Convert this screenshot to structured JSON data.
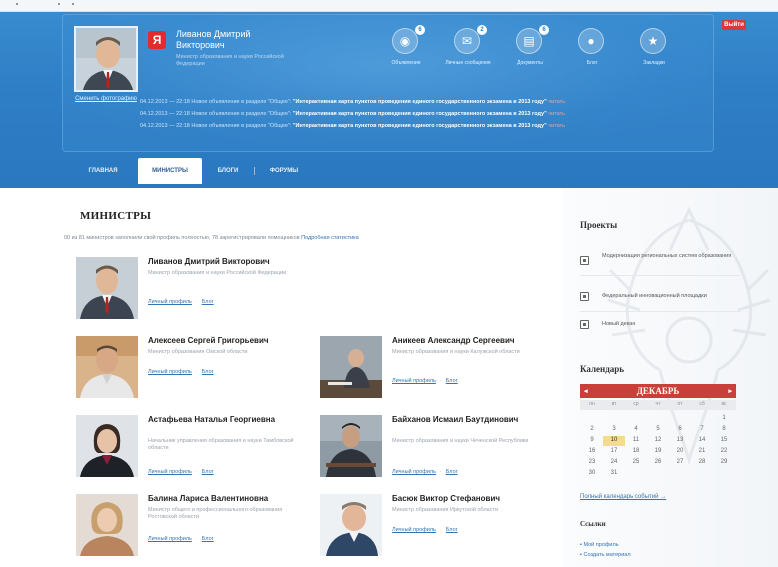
{
  "header": {
    "exit_label": "Выйти",
    "user": {
      "name": "Ливанов Дмитрий Викторович",
      "title": "Министр образования и науки Российской Федерации",
      "photo_link": "Сменить фотографию",
      "logo_letter": "Я"
    },
    "nav": [
      {
        "icon": "lightbulb-icon",
        "glyph": "◉",
        "label": "Объявления",
        "badge": "6"
      },
      {
        "icon": "mail-icon",
        "glyph": "✉",
        "label": "Личные сообщения",
        "badge": "2"
      },
      {
        "icon": "document-icon",
        "glyph": "▤",
        "label": "Документы",
        "badge": "6"
      },
      {
        "icon": "speech-bubble-icon",
        "glyph": "●",
        "label": "Блог",
        "badge": ""
      },
      {
        "icon": "star-icon",
        "glyph": "★",
        "label": "Закладки",
        "badge": ""
      }
    ],
    "news": [
      {
        "date": "04.12.2013 — 22:18",
        "text": "Новое объявление в разделе \"Общее\":",
        "bold": "\"Интерактивная карта пунктов проведения единого государственного экзамена в 2013 году\"",
        "more": "читать"
      },
      {
        "date": "04.12.2013 — 22:18",
        "text": "Новое объявление в разделе \"Общее\":",
        "bold": "\"Интерактивная карта пунктов проведения единого государственного экзамена в 2013 году\"",
        "more": "читать"
      },
      {
        "date": "04.12.2013 — 22:18",
        "text": "Новое объявление в разделе \"Общее\":",
        "bold": "\"Интерактивная карта пунктов проведения единого государственного экзамена в 2013 году\"",
        "more": "читать"
      }
    ],
    "tabs": [
      "ГЛАВНАЯ",
      "МИНИСТРЫ",
      "БЛОГИ",
      "ФОРУМЫ"
    ]
  },
  "main": {
    "title": "МИНИСТРЫ",
    "stats_text": "00 из 81 министров заполнили свой профиль полностью, 78 зарегистрировали помощников",
    "stats_link": "Подробная статистика",
    "ministers": [
      {
        "name": "Ливанов Дмитрий Викторович",
        "desc": "Министр образования и науки Российской Федерации",
        "profile": "Личный профиль",
        "blog": "Блог"
      },
      {
        "name": "Алексеев Сергей Григорьевич",
        "desc": "Министр образования Омской области",
        "profile": "Личный профиль",
        "blog": "Блог"
      },
      {
        "name": "Аникеев Александр Сергеевич",
        "desc": "Министр образования и науки Калужской области",
        "profile": "Личный профиль",
        "blog": "Блог"
      },
      {
        "name": "Астафьева Наталья Георгиевна",
        "desc": "Начальник управления образования и науки Тамбовской области",
        "profile": "Личный профиль",
        "blog": "Блог"
      },
      {
        "name": "Байханов Исмаил Баутдинович",
        "desc": "Министр образования и науки Чеченской Республики",
        "profile": "Личный профиль",
        "blog": "Блог"
      },
      {
        "name": "Балина Лариса Валентиновна",
        "desc": "Министр общего и профессионального образования Ростовской области",
        "profile": "Личный профиль",
        "blog": "Блог"
      },
      {
        "name": "Басюк Виктор Стефанович",
        "desc": "Министр образования Иркутской области",
        "profile": "Личный профиль",
        "blog": "Блог"
      }
    ]
  },
  "sidebar": {
    "projects_title": "Проекты",
    "projects": [
      "Модернизация региональных систем образования",
      "Федеральный инновационный площадки",
      "Новый декан"
    ],
    "calendar_title": "Календарь",
    "calendar": {
      "month": "ДЕКАБРЬ",
      "dow": [
        "пн",
        "вт",
        "ср",
        "чт",
        "пт",
        "сб",
        "вс"
      ],
      "weeks": [
        [
          "",
          "",
          "",
          "",
          "",
          "",
          "1"
        ],
        [
          "2",
          "3",
          "4",
          "5",
          "6",
          "7",
          "8"
        ],
        [
          "9",
          "10",
          "11",
          "12",
          "13",
          "14",
          "15"
        ],
        [
          "16",
          "17",
          "18",
          "19",
          "20",
          "21",
          "22"
        ],
        [
          "23",
          "24",
          "25",
          "26",
          "27",
          "28",
          "29"
        ],
        [
          "30",
          "31",
          "",
          "",
          "",
          "",
          ""
        ]
      ],
      "highlight": "10"
    },
    "calendar_link": "Полный календарь событий →",
    "links_title": "Ссылки",
    "links": [
      "Мой профиль",
      "Создать материал"
    ]
  }
}
